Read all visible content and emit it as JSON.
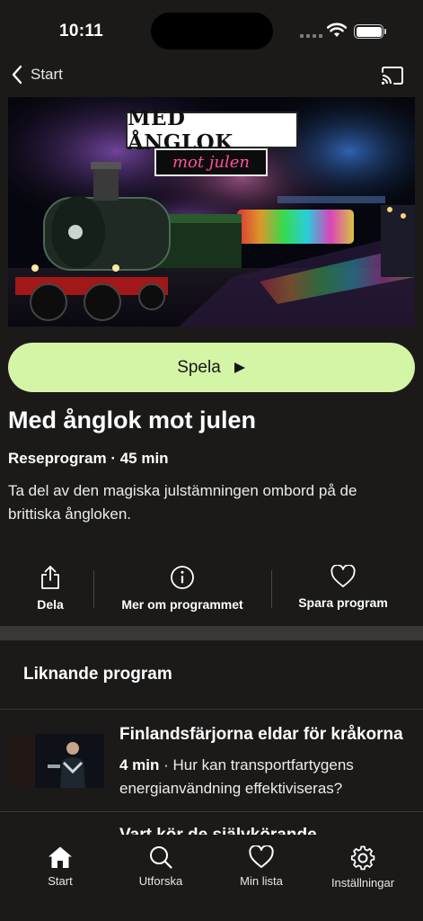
{
  "status_bar": {
    "time": "10:11"
  },
  "nav": {
    "back_label": "Start"
  },
  "hero": {
    "title_line1": "MED ÅNGLOK",
    "title_line2": "mot julen"
  },
  "play_button": {
    "label": "Spela"
  },
  "program": {
    "title": "Med ånglok mot julen",
    "meta": "Reseprogram · 45 min",
    "description": "Ta del av den magiska julstämningen ombord på de brittiska ångloken."
  },
  "actions": [
    {
      "label": "Dela",
      "icon": "share-icon"
    },
    {
      "label": "Mer om programmet",
      "icon": "info-icon"
    },
    {
      "label": "Spara program",
      "icon": "heart-icon"
    }
  ],
  "similar": {
    "heading": "Liknande program",
    "items": [
      {
        "title": "Finlandsfärjorna eldar för kråkorna",
        "duration": "4 min",
        "text": " · Hur kan transportfartygens energianvändning effektiviseras?"
      },
      {
        "title": "Vart kör de självkörande"
      }
    ]
  },
  "tabbar": [
    {
      "label": "Start",
      "icon": "home-icon"
    },
    {
      "label": "Utforska",
      "icon": "search-icon"
    },
    {
      "label": "Min lista",
      "icon": "heart-icon"
    },
    {
      "label": "Inställningar",
      "icon": "gear-icon"
    }
  ],
  "colors": {
    "background": "#1b1a19",
    "accent": "#d4f5a6",
    "text": "#ffffff"
  }
}
